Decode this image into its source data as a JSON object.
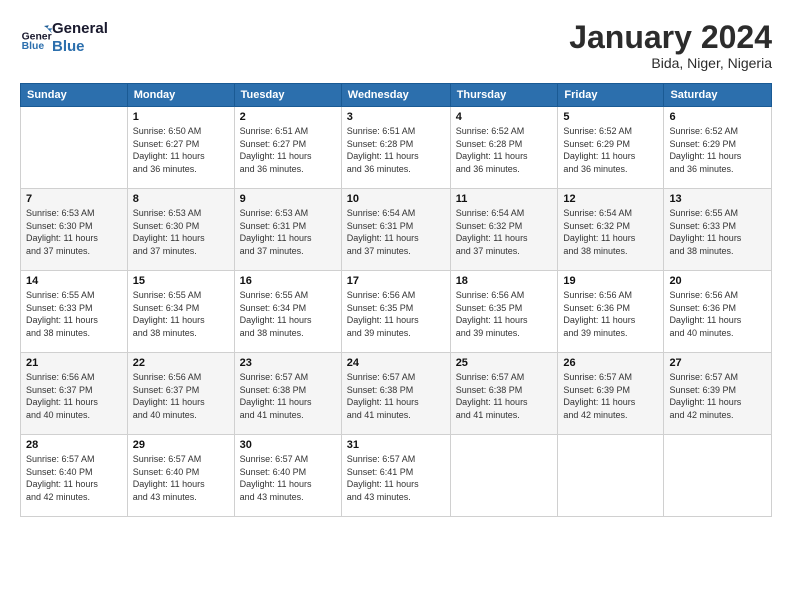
{
  "logo": {
    "line1": "General",
    "line2": "Blue"
  },
  "title": "January 2024",
  "location": "Bida, Niger, Nigeria",
  "days_of_week": [
    "Sunday",
    "Monday",
    "Tuesday",
    "Wednesday",
    "Thursday",
    "Friday",
    "Saturday"
  ],
  "weeks": [
    [
      {
        "day": "",
        "info": ""
      },
      {
        "day": "1",
        "info": "Sunrise: 6:50 AM\nSunset: 6:27 PM\nDaylight: 11 hours\nand 36 minutes."
      },
      {
        "day": "2",
        "info": "Sunrise: 6:51 AM\nSunset: 6:27 PM\nDaylight: 11 hours\nand 36 minutes."
      },
      {
        "day": "3",
        "info": "Sunrise: 6:51 AM\nSunset: 6:28 PM\nDaylight: 11 hours\nand 36 minutes."
      },
      {
        "day": "4",
        "info": "Sunrise: 6:52 AM\nSunset: 6:28 PM\nDaylight: 11 hours\nand 36 minutes."
      },
      {
        "day": "5",
        "info": "Sunrise: 6:52 AM\nSunset: 6:29 PM\nDaylight: 11 hours\nand 36 minutes."
      },
      {
        "day": "6",
        "info": "Sunrise: 6:52 AM\nSunset: 6:29 PM\nDaylight: 11 hours\nand 36 minutes."
      }
    ],
    [
      {
        "day": "7",
        "info": "Sunrise: 6:53 AM\nSunset: 6:30 PM\nDaylight: 11 hours\nand 37 minutes."
      },
      {
        "day": "8",
        "info": "Sunrise: 6:53 AM\nSunset: 6:30 PM\nDaylight: 11 hours\nand 37 minutes."
      },
      {
        "day": "9",
        "info": "Sunrise: 6:53 AM\nSunset: 6:31 PM\nDaylight: 11 hours\nand 37 minutes."
      },
      {
        "day": "10",
        "info": "Sunrise: 6:54 AM\nSunset: 6:31 PM\nDaylight: 11 hours\nand 37 minutes."
      },
      {
        "day": "11",
        "info": "Sunrise: 6:54 AM\nSunset: 6:32 PM\nDaylight: 11 hours\nand 37 minutes."
      },
      {
        "day": "12",
        "info": "Sunrise: 6:54 AM\nSunset: 6:32 PM\nDaylight: 11 hours\nand 38 minutes."
      },
      {
        "day": "13",
        "info": "Sunrise: 6:55 AM\nSunset: 6:33 PM\nDaylight: 11 hours\nand 38 minutes."
      }
    ],
    [
      {
        "day": "14",
        "info": "Sunrise: 6:55 AM\nSunset: 6:33 PM\nDaylight: 11 hours\nand 38 minutes."
      },
      {
        "day": "15",
        "info": "Sunrise: 6:55 AM\nSunset: 6:34 PM\nDaylight: 11 hours\nand 38 minutes."
      },
      {
        "day": "16",
        "info": "Sunrise: 6:55 AM\nSunset: 6:34 PM\nDaylight: 11 hours\nand 38 minutes."
      },
      {
        "day": "17",
        "info": "Sunrise: 6:56 AM\nSunset: 6:35 PM\nDaylight: 11 hours\nand 39 minutes."
      },
      {
        "day": "18",
        "info": "Sunrise: 6:56 AM\nSunset: 6:35 PM\nDaylight: 11 hours\nand 39 minutes."
      },
      {
        "day": "19",
        "info": "Sunrise: 6:56 AM\nSunset: 6:36 PM\nDaylight: 11 hours\nand 39 minutes."
      },
      {
        "day": "20",
        "info": "Sunrise: 6:56 AM\nSunset: 6:36 PM\nDaylight: 11 hours\nand 40 minutes."
      }
    ],
    [
      {
        "day": "21",
        "info": "Sunrise: 6:56 AM\nSunset: 6:37 PM\nDaylight: 11 hours\nand 40 minutes."
      },
      {
        "day": "22",
        "info": "Sunrise: 6:56 AM\nSunset: 6:37 PM\nDaylight: 11 hours\nand 40 minutes."
      },
      {
        "day": "23",
        "info": "Sunrise: 6:57 AM\nSunset: 6:38 PM\nDaylight: 11 hours\nand 41 minutes."
      },
      {
        "day": "24",
        "info": "Sunrise: 6:57 AM\nSunset: 6:38 PM\nDaylight: 11 hours\nand 41 minutes."
      },
      {
        "day": "25",
        "info": "Sunrise: 6:57 AM\nSunset: 6:38 PM\nDaylight: 11 hours\nand 41 minutes."
      },
      {
        "day": "26",
        "info": "Sunrise: 6:57 AM\nSunset: 6:39 PM\nDaylight: 11 hours\nand 42 minutes."
      },
      {
        "day": "27",
        "info": "Sunrise: 6:57 AM\nSunset: 6:39 PM\nDaylight: 11 hours\nand 42 minutes."
      }
    ],
    [
      {
        "day": "28",
        "info": "Sunrise: 6:57 AM\nSunset: 6:40 PM\nDaylight: 11 hours\nand 42 minutes."
      },
      {
        "day": "29",
        "info": "Sunrise: 6:57 AM\nSunset: 6:40 PM\nDaylight: 11 hours\nand 43 minutes."
      },
      {
        "day": "30",
        "info": "Sunrise: 6:57 AM\nSunset: 6:40 PM\nDaylight: 11 hours\nand 43 minutes."
      },
      {
        "day": "31",
        "info": "Sunrise: 6:57 AM\nSunset: 6:41 PM\nDaylight: 11 hours\nand 43 minutes."
      },
      {
        "day": "",
        "info": ""
      },
      {
        "day": "",
        "info": ""
      },
      {
        "day": "",
        "info": ""
      }
    ]
  ]
}
